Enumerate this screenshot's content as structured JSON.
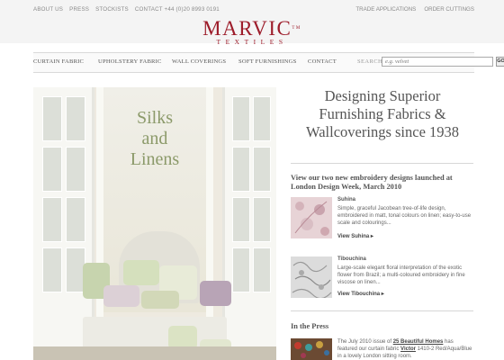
{
  "top_links": {
    "left": [
      "ABOUT US",
      "PRESS",
      "STOCKISTS",
      "CONTACT +44 (0)20 8993 0191"
    ],
    "right": [
      "TRADE APPLICATIONS",
      "ORDER CUTTINGS"
    ]
  },
  "logo": {
    "main": "MARVIC",
    "tm": "TM",
    "sub": "TEXTILES"
  },
  "nav": {
    "items": [
      "CURTAIN FABRIC",
      "UPHOLSTERY FABRIC",
      "WALL COVERINGS",
      "SOFT FURNISHINGS",
      "CONTACT"
    ],
    "search_label": "SEARCH",
    "search_placeholder": "e.g. velvet",
    "go_label": "GO"
  },
  "hero": {
    "title_line1": "Silks",
    "title_line2": "and",
    "title_line3": "Linens"
  },
  "headline": {
    "line1": "Designing Superior",
    "line2": "Furnishing Fabrics &",
    "line3": "Wallcoverings since 1938"
  },
  "embroidery": {
    "title": "View our two new embroidery designs launched at London Design Week, March 2010",
    "items": [
      {
        "name": "Suhina",
        "desc": "Simple, graceful Jacobean tree-of-life design, embroidered in matt, tonal colours on linen; easy-to-use scale and colourings...",
        "link": "View Suhina"
      },
      {
        "name": "Tibouchina",
        "desc": "Large-scale elegant floral interpretation of the exotic flower from Brazil; a multi-coloured embroidery in fine viscose on linen...",
        "link": "View Tibouchina"
      }
    ]
  },
  "press": {
    "title": "In the Press",
    "text_before": "The July 2010 issue of ",
    "magazine": "25 Beautiful Homes",
    "text_mid": " has featured our curtain fabric ",
    "fabric": "Victor",
    "text_after": " 1410-2 Red/Aqua/Blue in a lovely London sitting room."
  },
  "colors": {
    "brand": "#9d1c2a",
    "hero_title": "#8c9a6a",
    "text": "#555555"
  },
  "icons": {
    "link_arrow": "triangle-right-icon"
  }
}
